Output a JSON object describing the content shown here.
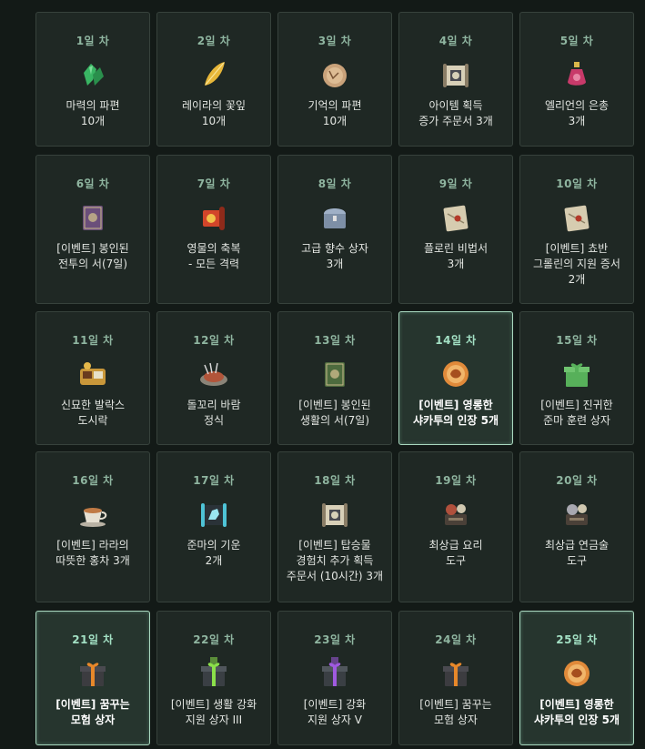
{
  "days": [
    {
      "day": "1일 차",
      "name": "마력의 파편\n10개",
      "icon": "green-crystal-shard-icon",
      "color": "#3cc46a"
    },
    {
      "day": "2일 차",
      "name": "레이라의 꽃잎\n10개",
      "icon": "golden-petal-icon",
      "color": "#e7b739"
    },
    {
      "day": "3일 차",
      "name": "기억의 파편\n10개",
      "icon": "memory-fragment-disc-icon",
      "color": "#c9a27a"
    },
    {
      "day": "4일 차",
      "name": "아이템 획득\n증가 주문서 3개",
      "icon": "scroll-icon",
      "color": "#d8d0b8"
    },
    {
      "day": "5일 차",
      "name": "엘리언의 은총\n3개",
      "icon": "potion-vial-icon",
      "color": "#c83a6a"
    },
    {
      "day": "6일 차",
      "name": "[이벤트] 봉인된\n전투의 서(7일)",
      "icon": "sealed-battle-book-icon",
      "color": "#6a4e7a"
    },
    {
      "day": "7일 차",
      "name": "영물의 축복\n- 모든 격력",
      "icon": "red-blessing-scroll-icon",
      "color": "#d2452a"
    },
    {
      "day": "8일 차",
      "name": "고급 향수 상자\n3개",
      "icon": "perfume-chest-icon",
      "color": "#7d8fa6"
    },
    {
      "day": "9일 차",
      "name": "플로린 비법서\n3개",
      "icon": "secret-letter-icon",
      "color": "#d6ccb0"
    },
    {
      "day": "10일 차",
      "name": "[이벤트] 쵸반\n그롤린의 지원 증서\n2개",
      "icon": "support-certificate-icon",
      "color": "#d6ccb0"
    },
    {
      "day": "11일 차",
      "name": "신묘한 발락스\n도시락",
      "icon": "lunch-box-icon",
      "color": "#c9973a"
    },
    {
      "day": "12일 차",
      "name": "돌꼬리 바람\n정식",
      "icon": "meat-dish-icon",
      "color": "#b2553a"
    },
    {
      "day": "13일 차",
      "name": "[이벤트] 봉인된\n생활의 서(7일)",
      "icon": "sealed-life-book-icon",
      "color": "#4d6b3e"
    },
    {
      "day": "14일 차",
      "name": "[이벤트] 영롱한\n샤카투의 인장 5개",
      "icon": "shakatu-seal-icon",
      "color": "#e08a3a",
      "highlight": true
    },
    {
      "day": "15일 차",
      "name": "[이벤트] 진귀한\n준마 훈련 상자",
      "icon": "green-gift-box-icon",
      "color": "#57b05a"
    },
    {
      "day": "16일 차",
      "name": "[이벤트] 라라의\n따뜻한 홍차 3개",
      "icon": "tea-cup-icon",
      "color": "#c07a45"
    },
    {
      "day": "17일 차",
      "name": "준마의 기운\n2개",
      "icon": "horse-scroll-icon",
      "color": "#4ec3d6"
    },
    {
      "day": "18일 차",
      "name": "[이벤트] 탑승물\n경험치 추가 획득\n주문서 (10시간) 3개",
      "icon": "mount-exp-scroll-icon",
      "color": "#d8d0b8"
    },
    {
      "day": "19일 차",
      "name": "최상급 요리\n도구",
      "icon": "cooking-tools-icon",
      "color": "#b0503c"
    },
    {
      "day": "20일 차",
      "name": "최상급 연금술\n도구",
      "icon": "alchemy-tools-icon",
      "color": "#a8a8b0"
    },
    {
      "day": "21일 차",
      "name": "[이벤트] 꿈꾸는\n모험 상자",
      "icon": "adventure-gift-box-icon",
      "color": "#e8882a",
      "highlight": true
    },
    {
      "day": "22일 차",
      "name": "[이벤트] 생활 강화\n지원 상자 III",
      "icon": "green-glow-box-icon",
      "color": "#8be04a"
    },
    {
      "day": "23일 차",
      "name": "[이벤트] 강화\n지원 상자 V",
      "icon": "purple-glow-box-icon",
      "color": "#a05ae0"
    },
    {
      "day": "24일 차",
      "name": "[이벤트] 꿈꾸는\n모험 상자",
      "icon": "adventure-gift-box-icon",
      "color": "#e8882a"
    },
    {
      "day": "25일 차",
      "name": "[이벤트] 영롱한\n샤카투의 인장 5개",
      "icon": "shakatu-seal-icon",
      "color": "#e08a3a",
      "highlight": true
    }
  ]
}
